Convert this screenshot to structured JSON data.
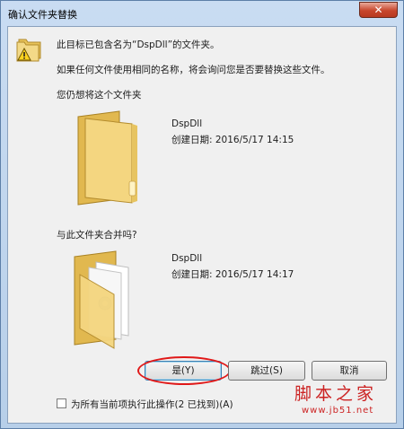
{
  "window": {
    "title": "确认文件夹替换",
    "close_label": "✕"
  },
  "message": {
    "line1": "此目标已包含名为“DspDll”的文件夹。",
    "line2": "如果任何文件使用相同的名称，将会询问您是否要替换这些文件。",
    "prompt1": "您仍想将这个文件夹",
    "prompt2": "与此文件夹合并吗?"
  },
  "existing": {
    "name": "DspDll",
    "created": "创建日期: 2016/5/17 14:15"
  },
  "incoming": {
    "name": "DspDll",
    "created": "创建日期: 2016/5/17 14:17"
  },
  "buttons": {
    "yes": "是(Y)",
    "skip": "跳过(S)",
    "cancel": "取消"
  },
  "checkbox": {
    "label": "为所有当前项执行此操作(2 已找到)(A)",
    "checked": false
  },
  "watermark": {
    "line1": "脚本之家",
    "line2": "www.jb51.net"
  },
  "colors": {
    "highlight_oval": "#e01818",
    "folder": "#f2d37a",
    "titlebar": "#c9dcf2"
  },
  "icons": {
    "warning": "warning-folder-icon",
    "folder_empty": "folder-icon",
    "folder_with_files": "folder-with-files-icon"
  }
}
